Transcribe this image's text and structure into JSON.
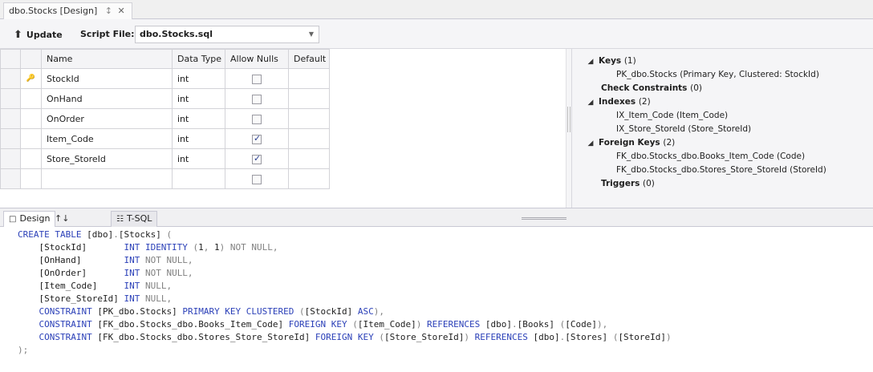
{
  "document_tab": {
    "title": "dbo.Stocks [Design]",
    "pin": "↕",
    "close": "✕"
  },
  "toolbar": {
    "update_label": "Update",
    "script_file_label": "Script File:",
    "script_file_value": "dbo.Stocks.sql"
  },
  "grid": {
    "headers": {
      "name": "Name",
      "data_type": "Data Type",
      "allow_nulls": "Allow Nulls",
      "default": "Default"
    },
    "rows": [
      {
        "name": "StockId",
        "data_type": "int",
        "allow_nulls": false,
        "default": "",
        "primary_key": true
      },
      {
        "name": "OnHand",
        "data_type": "int",
        "allow_nulls": false,
        "default": ""
      },
      {
        "name": "OnOrder",
        "data_type": "int",
        "allow_nulls": false,
        "default": ""
      },
      {
        "name": "Item_Code",
        "data_type": "int",
        "allow_nulls": true,
        "default": ""
      },
      {
        "name": "Store_StoreId",
        "data_type": "int",
        "allow_nulls": true,
        "default": ""
      },
      {
        "name": "",
        "data_type": "",
        "allow_nulls": false,
        "default": ""
      }
    ]
  },
  "properties": {
    "keys_label": "Keys",
    "keys_count": "(1)",
    "key_item": "PK_dbo.Stocks   (Primary Key, Clustered: StockId)",
    "check_label": "Check Constraints",
    "check_count": "(0)",
    "indexes_label": "Indexes",
    "indexes_count": "(2)",
    "index_items": [
      "IX_Item_Code   (Item_Code)",
      "IX_Store_StoreId   (Store_StoreId)"
    ],
    "fk_label": "Foreign Keys",
    "fk_count": "(2)",
    "fk_items": [
      "FK_dbo.Stocks_dbo.Books_Item_Code   (Code)",
      "FK_dbo.Stocks_dbo.Stores_Store_StoreId   (StoreId)"
    ],
    "triggers_label": "Triggers",
    "triggers_count": "(0)"
  },
  "bottom_tabs": {
    "design": "Design",
    "swap": "↑↓",
    "tsql": "T-SQL"
  },
  "sql_lines": [
    [
      [
        "kw",
        "CREATE TABLE "
      ],
      [
        "bk",
        "[dbo]"
      ],
      [
        "gr",
        "."
      ],
      [
        "bk",
        "[Stocks]"
      ],
      [
        "gr",
        " ("
      ]
    ],
    [
      [
        "bk",
        "    [StockId]       "
      ],
      [
        "kw",
        "INT IDENTITY "
      ],
      [
        "gr",
        "("
      ],
      [
        "bk",
        "1"
      ],
      [
        "gr",
        ", "
      ],
      [
        "bk",
        "1"
      ],
      [
        "gr",
        ") "
      ],
      [
        "gr",
        "NOT NULL,"
      ]
    ],
    [
      [
        "bk",
        "    [OnHand]        "
      ],
      [
        "kw",
        "INT "
      ],
      [
        "gr",
        "NOT NULL,"
      ]
    ],
    [
      [
        "bk",
        "    [OnOrder]       "
      ],
      [
        "kw",
        "INT "
      ],
      [
        "gr",
        "NOT NULL,"
      ]
    ],
    [
      [
        "bk",
        "    [Item_Code]     "
      ],
      [
        "kw",
        "INT "
      ],
      [
        "gr",
        "NULL,"
      ]
    ],
    [
      [
        "bk",
        "    [Store_StoreId] "
      ],
      [
        "kw",
        "INT "
      ],
      [
        "gr",
        "NULL,"
      ]
    ],
    [
      [
        "bk",
        "    "
      ],
      [
        "kw",
        "CONSTRAINT "
      ],
      [
        "bk",
        "[PK_dbo.Stocks] "
      ],
      [
        "kw",
        "PRIMARY KEY CLUSTERED "
      ],
      [
        "gr",
        "("
      ],
      [
        "bk",
        "[StockId] "
      ],
      [
        "kw",
        "ASC"
      ],
      [
        "gr",
        "),"
      ]
    ],
    [
      [
        "bk",
        "    "
      ],
      [
        "kw",
        "CONSTRAINT "
      ],
      [
        "bk",
        "[FK_dbo.Stocks_dbo.Books_Item_Code] "
      ],
      [
        "kw",
        "FOREIGN KEY "
      ],
      [
        "gr",
        "("
      ],
      [
        "bk",
        "[Item_Code]"
      ],
      [
        "gr",
        ") "
      ],
      [
        "kw",
        "REFERENCES "
      ],
      [
        "bk",
        "[dbo]"
      ],
      [
        "gr",
        "."
      ],
      [
        "bk",
        "[Books] "
      ],
      [
        "gr",
        "("
      ],
      [
        "bk",
        "[Code]"
      ],
      [
        "gr",
        "),"
      ]
    ],
    [
      [
        "bk",
        "    "
      ],
      [
        "kw",
        "CONSTRAINT "
      ],
      [
        "bk",
        "[FK_dbo.Stocks_dbo.Stores_Store_StoreId] "
      ],
      [
        "kw",
        "FOREIGN KEY "
      ],
      [
        "gr",
        "("
      ],
      [
        "bk",
        "[Store_StoreId]"
      ],
      [
        "gr",
        ") "
      ],
      [
        "kw",
        "REFERENCES "
      ],
      [
        "bk",
        "[dbo]"
      ],
      [
        "gr",
        "."
      ],
      [
        "bk",
        "[Stores] "
      ],
      [
        "gr",
        "("
      ],
      [
        "bk",
        "[StoreId]"
      ],
      [
        "gr",
        ")"
      ]
    ],
    [
      [
        "gr",
        ");"
      ]
    ]
  ]
}
